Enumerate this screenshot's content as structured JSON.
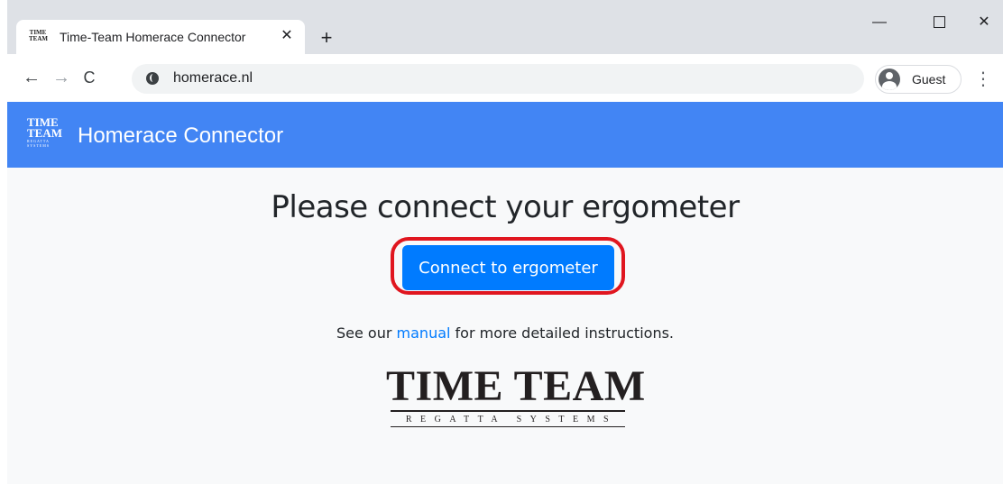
{
  "browser": {
    "tab": {
      "favicon_text": "TIME TEAM",
      "title": "Time-Team Homerace Connector",
      "close_glyph": "✕"
    },
    "new_tab_glyph": "+",
    "window_controls": {
      "minimize_glyph": "—",
      "close_glyph": "✕"
    },
    "nav": {
      "back_glyph": "←",
      "forward_glyph": "→",
      "reload_glyph": "C"
    },
    "address_bar": {
      "url": "homerace.nl",
      "icon": "globe-icon"
    },
    "profile": {
      "label": "Guest",
      "icon": "avatar-icon"
    },
    "menu_glyph": "⋮"
  },
  "navbar": {
    "logo_text_line1": "TIME",
    "logo_text_line2": "TEAM",
    "logo_text_small": "REGATTA SYSTEMS",
    "title": "Homerace Connector",
    "color": "#4285f4"
  },
  "main": {
    "heading": "Please connect your ergometer",
    "connect_button": "Connect to ergometer",
    "instructions_prefix": "See our",
    "instructions_link": "manual",
    "instructions_suffix": "for more detailed instructions.",
    "highlight_color": "#e0161f",
    "button_color": "#007bff"
  },
  "footer_logo": {
    "main": "TIME TEAM",
    "sub": "REGATTA SYSTEMS"
  }
}
